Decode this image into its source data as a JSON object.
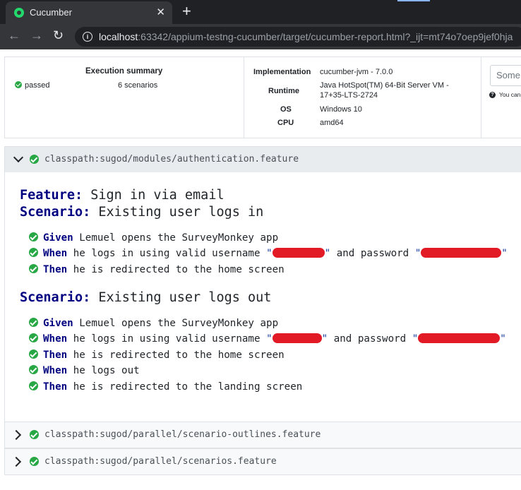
{
  "browser": {
    "tab_title": "Cucumber",
    "url_host": "localhost",
    "url_rest": ":63342/appium-testng-cucumber/target/cucumber-report.html?_ijt=mt74o7oep9jef0hja"
  },
  "summary": {
    "title": "Execution summary",
    "status": "passed",
    "count": "6 scenarios"
  },
  "environment": [
    {
      "label": "Implementation",
      "value": "cucumber-jvm - 7.0.0"
    },
    {
      "label": "Runtime",
      "value": "Java HotSpot(TM) 64-Bit Server VM - 17+35-LTS-2724"
    },
    {
      "label": "OS",
      "value": "Windows 10"
    },
    {
      "label": "CPU",
      "value": "amd64"
    }
  ],
  "search": {
    "placeholder": "Some",
    "help": "You can"
  },
  "features": [
    {
      "path": "classpath:sugod/modules/authentication.feature",
      "expanded": true,
      "feature_keyword": "Feature:",
      "feature_name": "Sign in via email",
      "scenarios": [
        {
          "keyword": "Scenario:",
          "name": "Existing user logs in",
          "steps": [
            {
              "keyword": "Given",
              "text": "Lemuel opens the SurveyMonkey app"
            },
            {
              "keyword": "When",
              "text": "he logs in using valid username",
              "mid": "and password"
            },
            {
              "keyword": "Then",
              "text": "he is redirected to the home screen"
            }
          ]
        },
        {
          "keyword": "Scenario:",
          "name": "Existing user logs out",
          "steps": [
            {
              "keyword": "Given",
              "text": "Lemuel opens the SurveyMonkey app"
            },
            {
              "keyword": "When",
              "text": "he logs in using valid username",
              "mid": "and password"
            },
            {
              "keyword": "Then",
              "text": "he is redirected to the home screen"
            },
            {
              "keyword": "When",
              "text": "he logs out"
            },
            {
              "keyword": "Then",
              "text": "he is redirected to the landing screen"
            }
          ]
        }
      ]
    },
    {
      "path": "classpath:sugod/parallel/scenario-outlines.feature",
      "expanded": false
    },
    {
      "path": "classpath:sugod/parallel/scenarios.feature",
      "expanded": false
    }
  ],
  "colors": {
    "passed": "#28a745",
    "keyword": "#000080",
    "redaction": "#e21a26"
  }
}
